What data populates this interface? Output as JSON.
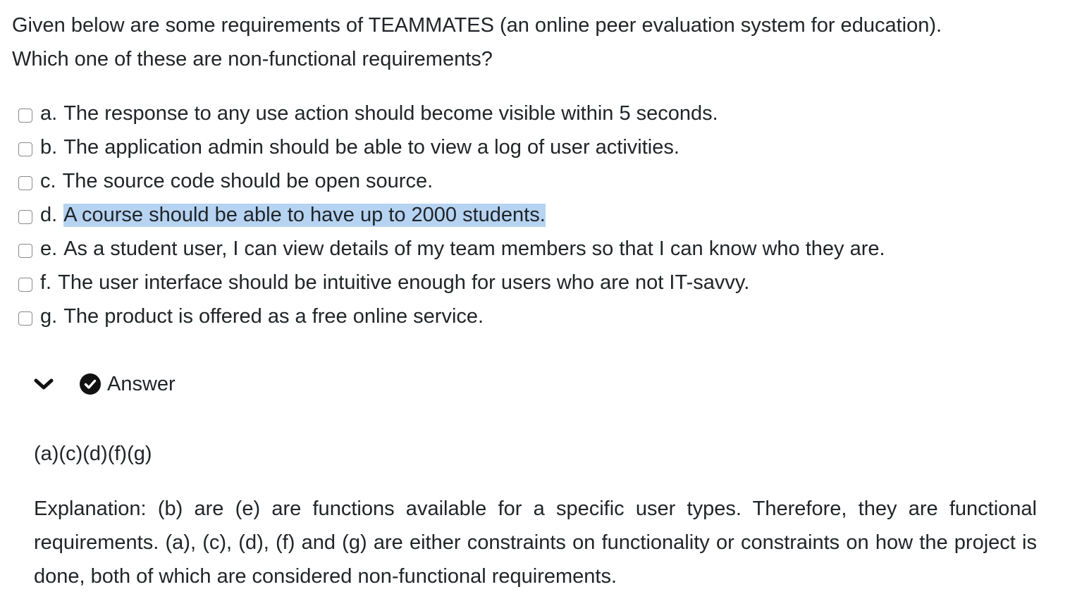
{
  "question": {
    "line1": "Given below are some requirements of TEAMMATES (an online peer evaluation system for education).",
    "line2": "Which one of these are non-functional requirements?"
  },
  "options": [
    {
      "letter": "a.",
      "text": "The response to any use action should become visible within 5 seconds.",
      "checked": false
    },
    {
      "letter": "b.",
      "text": "The application admin should be able to view a log of user activities.",
      "checked": false
    },
    {
      "letter": "c.",
      "text": "The source code should be open source.",
      "checked": false
    },
    {
      "letter": "d.",
      "text": "A course should be able to have up to 2000 students.",
      "checked": false,
      "text_selected": true
    },
    {
      "letter": "e.",
      "text": "As a student user, I can view details of my team members so that I can know who they are.",
      "checked": false
    },
    {
      "letter": "f.",
      "text": "The user interface should be intuitive enough for users who are not IT-savvy.",
      "checked": false
    },
    {
      "letter": "g.",
      "text": "The product is offered as a free online service.",
      "checked": false
    }
  ],
  "answer": {
    "toggle_label": "Answer",
    "expanded": true,
    "chevron_icon": "chevron-down-icon",
    "status_icon": "check-circle-icon",
    "value": "(a)(c)(d)(f)(g)",
    "explanation": "Explanation: (b) are (e) are functions available for a specific user types. Therefore, they are functional requirements. (a), (c), (d), (f) and (g) are either constraints on functionality or constraints on how the project is done, both of which are considered non-functional requirements."
  },
  "colors": {
    "text": "#212529",
    "selection_highlight": "#b6d3f2",
    "checkbox_border": "#8a8a8a"
  }
}
